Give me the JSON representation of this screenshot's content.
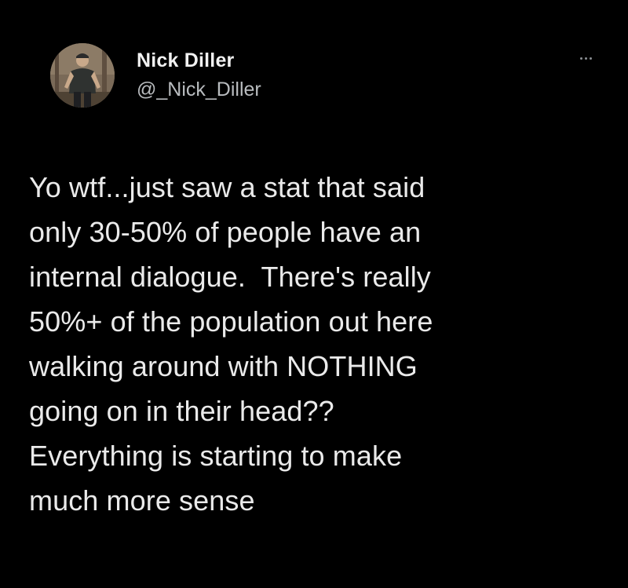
{
  "author": {
    "display_name": "Nick Diller",
    "handle": "@_Nick_Diller",
    "avatar_icon": "user-photo-avatar"
  },
  "menu": {
    "more_icon": "more-horizontal-icon"
  },
  "tweet": {
    "text": "Yo wtf...just saw a stat that said\nonly 30-50% of people have an\ninternal dialogue.  There's really\n50%+ of the population out here\nwalking around with NOTHING\ngoing on in their head??\nEverything is starting to make\nmuch more sense"
  },
  "colors": {
    "background": "#000000",
    "text": "#eaeaea",
    "secondary_text": "#b9bcbf"
  }
}
